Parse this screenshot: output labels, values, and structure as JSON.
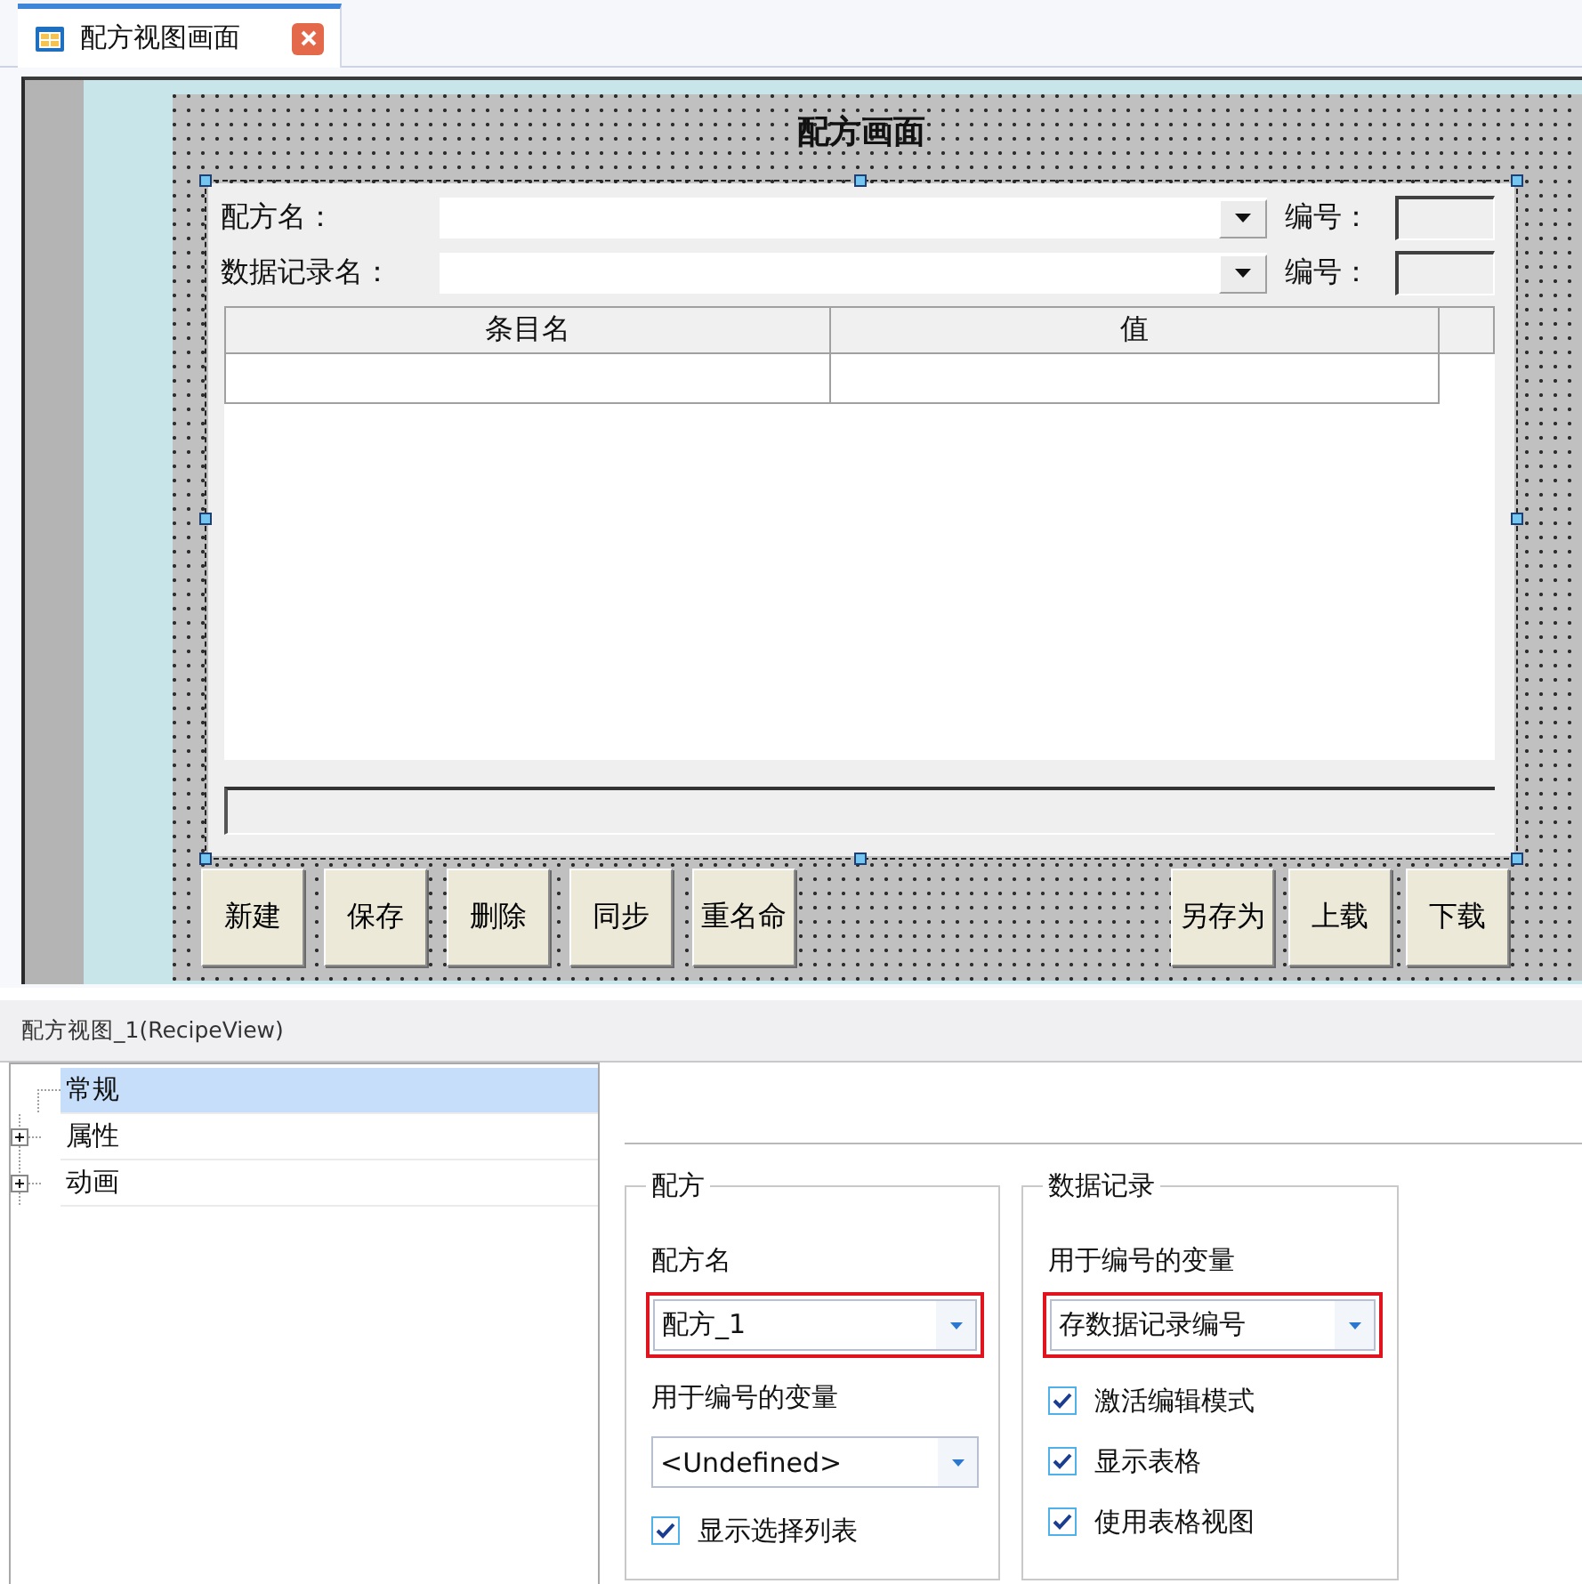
{
  "tabs": [
    {
      "label": "配方视图画面",
      "selected": true
    }
  ],
  "canvas": {
    "title": "配方画面",
    "recipe_view": {
      "selected": true,
      "fields": [
        {
          "label": "配方名：",
          "number_label": "编号："
        },
        {
          "label": "数据记录名：",
          "number_label": "编号："
        }
      ],
      "table": {
        "columns": [
          "条目名",
          "值"
        ]
      }
    },
    "buttons_left": [
      "新建",
      "保存",
      "删除",
      "同步",
      "重名命"
    ],
    "buttons_right": [
      "另存为",
      "上载",
      "下载"
    ]
  },
  "properties": {
    "title": "配方视图_1(RecipeView)",
    "tree": [
      {
        "label": "常规",
        "kind": "leaf",
        "selected": true
      },
      {
        "label": "属性",
        "kind": "group",
        "selected": false,
        "expanded": false
      },
      {
        "label": "动画",
        "kind": "group",
        "selected": false,
        "expanded": false
      }
    ],
    "groups": [
      {
        "title": "配方",
        "items": [
          {
            "kind": "label",
            "text": "配方名"
          },
          {
            "kind": "dropdown",
            "value": "配方_1",
            "highlighted": true
          },
          {
            "kind": "label",
            "text": "用于编号的变量"
          },
          {
            "kind": "dropdown",
            "value": "<Undefined>",
            "highlighted": false
          },
          {
            "kind": "checkbox",
            "label": "显示选择列表",
            "checked": true
          }
        ]
      },
      {
        "title": "数据记录",
        "items": [
          {
            "kind": "label",
            "text": "用于编号的变量"
          },
          {
            "kind": "dropdown",
            "value": "存数据记录编号",
            "highlighted": true
          },
          {
            "kind": "checkbox",
            "label": "激活编辑模式",
            "checked": true
          },
          {
            "kind": "checkbox",
            "label": "显示表格",
            "checked": true
          },
          {
            "kind": "checkbox",
            "label": "使用表格视图",
            "checked": true
          }
        ]
      }
    ]
  }
}
